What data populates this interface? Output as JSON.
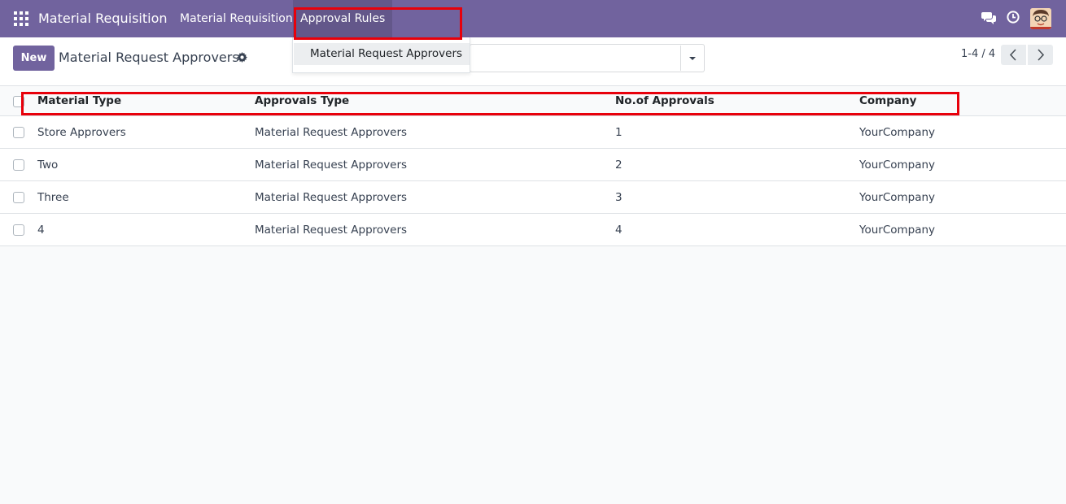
{
  "navbar": {
    "brand": "Material Requisition",
    "menus": [
      {
        "label": "Material Requisition"
      },
      {
        "label": "Approval Rules"
      }
    ],
    "accent_color": "#71639e"
  },
  "dropdown": {
    "items": [
      {
        "label": "Material Request Approvers"
      }
    ]
  },
  "control_panel": {
    "new_label": "New",
    "title": "Material Request Approvers",
    "search": {
      "value": "",
      "placeholder": ""
    },
    "pager": {
      "value": "1-4 / 4"
    }
  },
  "table": {
    "columns": [
      "Material Type",
      "Approvals Type",
      "No.of Approvals",
      "Company"
    ],
    "rows": [
      {
        "material_type": "Store Approvers",
        "approvals_type": "Material Request Approvers",
        "count": "1",
        "company": "YourCompany"
      },
      {
        "material_type": "Two",
        "approvals_type": "Material Request Approvers",
        "count": "2",
        "company": "YourCompany"
      },
      {
        "material_type": "Three",
        "approvals_type": "Material Request Approvers",
        "count": "3",
        "company": "YourCompany"
      },
      {
        "material_type": "4",
        "approvals_type": "Material Request Approvers",
        "count": "4",
        "company": "YourCompany"
      }
    ]
  },
  "icons": [
    "apps-icon",
    "chat-icon",
    "clock-icon",
    "avatar",
    "gear-icon",
    "caret-down-icon",
    "chevron-left-icon",
    "chevron-right-icon"
  ],
  "highlight_color": "#e8000b"
}
